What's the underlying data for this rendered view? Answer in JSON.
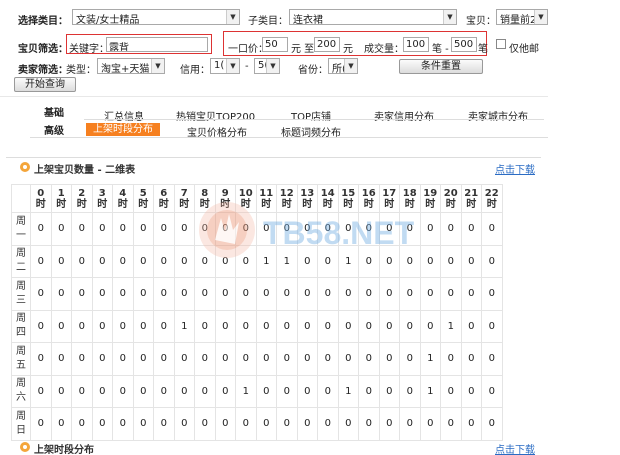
{
  "filters": {
    "category_label": "选择类目：",
    "category_value": "文装/女士精品",
    "subcategory_label": "子类目：",
    "subcategory_value": "连衣裙",
    "listing_label": "宝贝：",
    "listing_value": "销量前2",
    "item_filter_label": "宝贝筛选：",
    "keyword_label": "关键字：",
    "keyword_value": "露背",
    "price_label": "一口价：",
    "price_min": "50",
    "price_unit": "元 至",
    "price_max": "200",
    "price_unit2": "元",
    "volume_label": "成交量：",
    "volume_min": "100",
    "volume_unit": "笔 -",
    "volume_max": "500",
    "volume_unit2": "笔",
    "mall_only_label": "仅他邮",
    "seller_filter_label": "卖家筛选：",
    "type_label": "类型：",
    "type_value": "淘宝+天猫",
    "credit_label": "信用：",
    "credit_min": "1(",
    "credit_sep": "-",
    "credit_max": "5(",
    "province_label": "省份：",
    "province_value": "所(",
    "reset_button": "条件重置",
    "query_button": "开始查询"
  },
  "tabs": {
    "basic_label": "基础",
    "advanced_label": "高级",
    "row1": [
      "汇总信息",
      "热销宝贝TOP200",
      "TOP店铺",
      "卖家信用分布",
      "卖家城市分布"
    ],
    "row2_active": "上架时段分布",
    "row2": [
      "宝贝价格分布",
      "标题词频分布"
    ]
  },
  "section1": {
    "title": "上架宝贝数量 - 二维表",
    "download": "点击下载"
  },
  "section2": {
    "title": "上架时段分布",
    "download": "点击下载"
  },
  "watermark": "TB58.NET",
  "table": {
    "hours": [
      "0",
      "1",
      "2",
      "3",
      "4",
      "5",
      "6",
      "7",
      "8",
      "9",
      "10",
      "11",
      "12",
      "13",
      "14",
      "15",
      "16",
      "17",
      "18",
      "19",
      "20",
      "21",
      "22"
    ],
    "hour_suffix": "时",
    "days": [
      {
        "c1": "周",
        "c2": "一",
        "vals": [
          "0",
          "0",
          "0",
          "0",
          "0",
          "0",
          "0",
          "0",
          "0",
          "0",
          "0",
          "0",
          "0",
          "0",
          "0",
          "0",
          "0",
          "0",
          "0",
          "0",
          "0",
          "0",
          "0"
        ]
      },
      {
        "c1": "周",
        "c2": "二",
        "vals": [
          "0",
          "0",
          "0",
          "0",
          "0",
          "0",
          "0",
          "0",
          "0",
          "0",
          "0",
          "1",
          "1",
          "0",
          "0",
          "1",
          "0",
          "0",
          "0",
          "0",
          "0",
          "0",
          "0"
        ]
      },
      {
        "c1": "周",
        "c2": "三",
        "vals": [
          "0",
          "0",
          "0",
          "0",
          "0",
          "0",
          "0",
          "0",
          "0",
          "0",
          "0",
          "0",
          "0",
          "0",
          "0",
          "0",
          "0",
          "0",
          "0",
          "0",
          "0",
          "0",
          "0"
        ]
      },
      {
        "c1": "周",
        "c2": "四",
        "vals": [
          "0",
          "0",
          "0",
          "0",
          "0",
          "0",
          "0",
          "1",
          "0",
          "0",
          "0",
          "0",
          "0",
          "0",
          "0",
          "0",
          "0",
          "0",
          "0",
          "0",
          "1",
          "0",
          "0"
        ]
      },
      {
        "c1": "周",
        "c2": "五",
        "vals": [
          "0",
          "0",
          "0",
          "0",
          "0",
          "0",
          "0",
          "0",
          "0",
          "0",
          "0",
          "0",
          "0",
          "0",
          "0",
          "0",
          "0",
          "0",
          "0",
          "1",
          "0",
          "0",
          "0"
        ]
      },
      {
        "c1": "周",
        "c2": "六",
        "vals": [
          "0",
          "0",
          "0",
          "0",
          "0",
          "0",
          "0",
          "0",
          "0",
          "0",
          "1",
          "0",
          "0",
          "0",
          "0",
          "1",
          "0",
          "0",
          "0",
          "1",
          "0",
          "0",
          "0"
        ]
      },
      {
        "c1": "周",
        "c2": "日",
        "vals": [
          "0",
          "0",
          "0",
          "0",
          "0",
          "0",
          "0",
          "0",
          "0",
          "0",
          "0",
          "0",
          "0",
          "0",
          "0",
          "0",
          "0",
          "0",
          "0",
          "0",
          "0",
          "0",
          "0"
        ]
      }
    ]
  }
}
